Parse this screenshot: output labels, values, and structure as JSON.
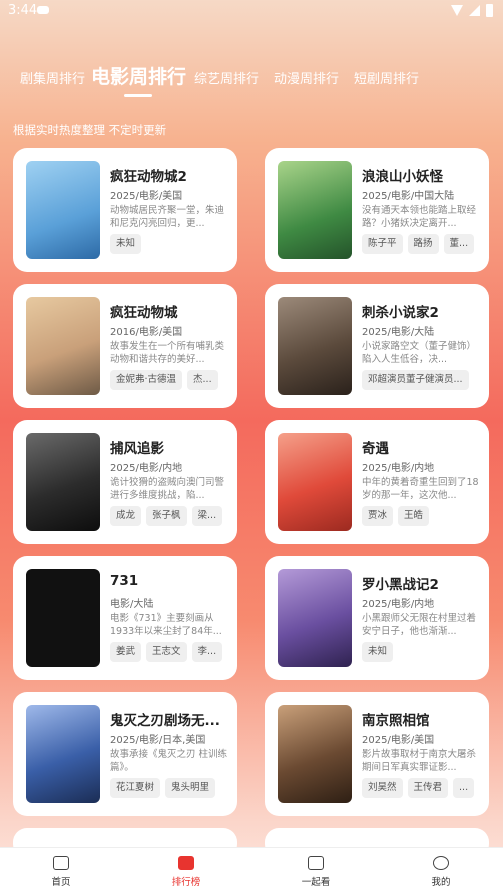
{
  "status": {
    "time": "3:44"
  },
  "tabs": [
    "剧集周排行",
    "电影周排行",
    "综艺周排行",
    "动漫周排行",
    "短剧周排行"
  ],
  "active_tab": "电影周排行",
  "subtitle": "根据实时热度整理 不定时更新",
  "movies": [
    {
      "title": "疯狂动物城2",
      "meta": "2025/电影/美国",
      "desc": "动物城居民齐聚一堂，朱迪和尼克闪亮回归，更...",
      "tags": [
        "未知"
      ],
      "poster_color": "#5aa0d8"
    },
    {
      "title": "浪浪山小妖怪",
      "meta": "2025/电影/中国大陆",
      "desc": "没有通天本领也能踏上取经路？小猪妖决定离开...",
      "tags": [
        "陈子平",
        "路扬",
        "董..."
      ],
      "poster_color": "#3f8a43"
    },
    {
      "title": "疯狂动物城",
      "meta": "2016/电影/美国",
      "desc": "故事发生在一个所有哺乳类动物和谐共存的美好...",
      "tags": [
        "金妮弗·古德温",
        "杰..."
      ],
      "poster_color": "#c9a07a"
    },
    {
      "title": "刺杀小说家2",
      "meta": "2025/电影/大陆",
      "desc": "小说家路空文（董子健饰）陷入人生低谷，决...",
      "tags": [
        "邓超演员董子健演员..."
      ],
      "poster_color": "#5b4a3c"
    },
    {
      "title": "捕风追影",
      "meta": "2025/电影/内地",
      "desc": "诡计狡猾的盗贼向澳门司警进行多维度挑战，陷...",
      "tags": [
        "成龙",
        "张子枫",
        "梁..."
      ],
      "poster_color": "#2c2c2c"
    },
    {
      "title": "奇遇",
      "meta": "2025/电影/内地",
      "desc": "中年的黄着奇重生回到了18岁的那一年，这次他...",
      "tags": [
        "贾冰",
        "王皓"
      ],
      "poster_color": "#e04a3a"
    },
    {
      "title": "731",
      "meta": "电影/大陆",
      "desc": "电影《731》主要刻画从1933年以来尘封了84年...",
      "tags": [
        "姜武",
        "王志文",
        "李..."
      ],
      "poster_color": "#111111"
    },
    {
      "title": "罗小黑战记2",
      "meta": "2025/电影/内地",
      "desc": "小黑跟师父无限在村里过着安宁日子，他也渐渐...",
      "tags": [
        "未知"
      ],
      "poster_color": "#6a4fa0"
    },
    {
      "title": "鬼灭之刃剧场无...",
      "meta": "2025/电影/日本,美国",
      "desc": "故事承接《鬼灭之刃 柱训练篇》。",
      "tags": [
        "花江夏树",
        "鬼头明里"
      ],
      "poster_color": "#3a5fa8"
    },
    {
      "title": "南京照相馆",
      "meta": "2025/电影/美国",
      "desc": "影片故事取材于南京大屠杀期间日军真实罪证影...",
      "tags": [
        "刘昊然",
        "王传君",
        "..."
      ],
      "poster_color": "#6b4a32"
    }
  ],
  "bottom_nav": [
    {
      "label": "首页"
    },
    {
      "label": "排行榜"
    },
    {
      "label": "一起看"
    },
    {
      "label": "我的"
    }
  ],
  "colors": {
    "accent": "#e8342f"
  }
}
